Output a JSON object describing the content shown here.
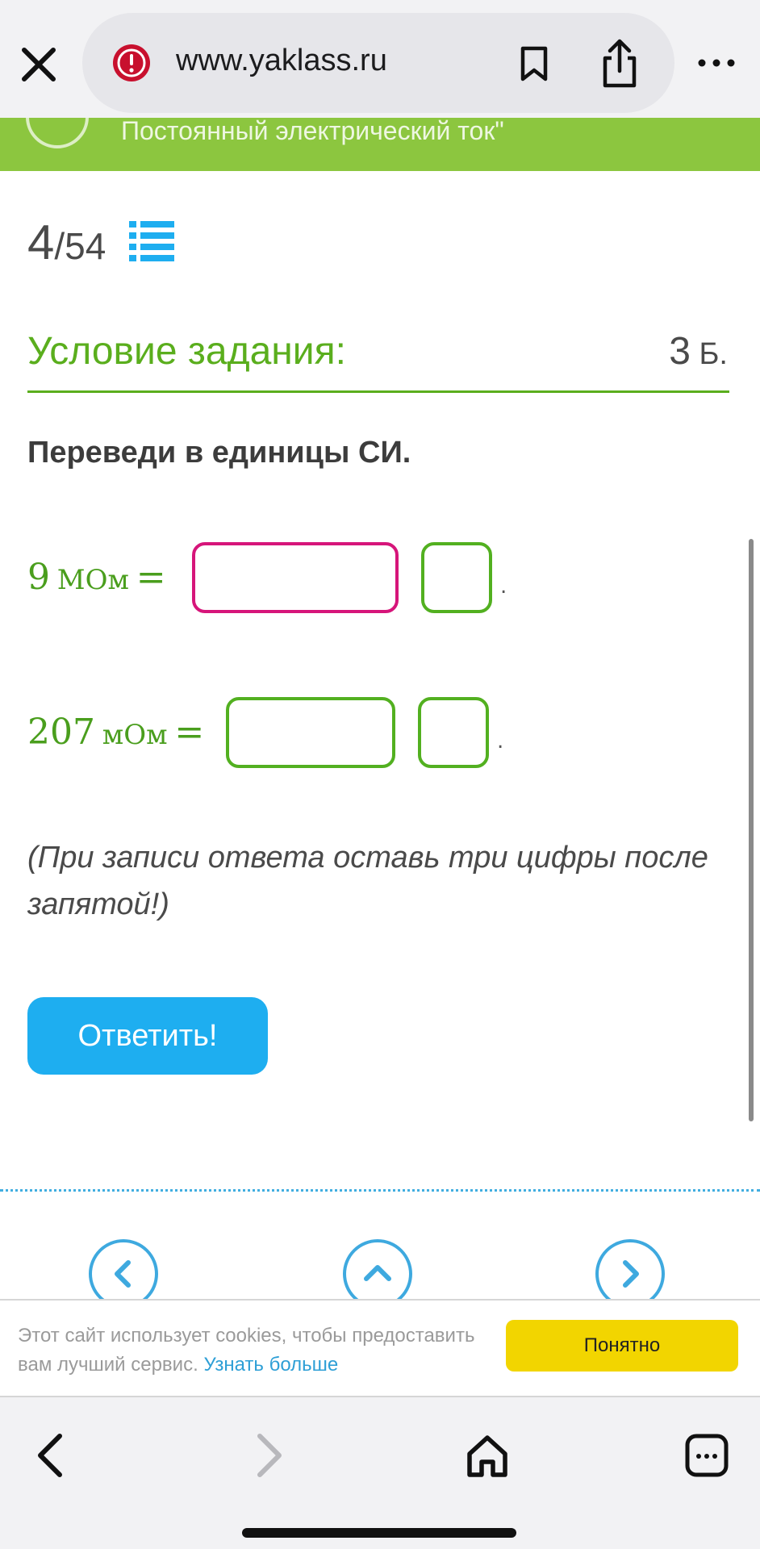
{
  "browser": {
    "url": "www.yaklass.ru"
  },
  "banner": {
    "topic": "Постоянный электрический ток\""
  },
  "progress": {
    "current": "4",
    "total": "/54"
  },
  "task": {
    "title": "Условие задания:",
    "points": "3",
    "points_unit": " Б.",
    "instruction": "Переведи в единицы СИ.",
    "equations": [
      {
        "value": "9",
        "unit": "МОм",
        "equals": "=",
        "input_value": "",
        "unit_value": "",
        "terminator": "."
      },
      {
        "value": "207",
        "unit": "мОм",
        "equals": "=",
        "input_value": "",
        "unit_value": "",
        "terminator": "."
      }
    ],
    "note": "(При записи ответа оставь три цифры после запятой!)",
    "submit_label": "Ответить!"
  },
  "cookie": {
    "text": "Этот сайт использует cookies, чтобы предоставить вам лучший сервис.",
    "link": "Узнать больше",
    "button": "Понятно"
  },
  "colors": {
    "brand_green": "#8cc63f",
    "task_green": "#5aae1d",
    "active_input": "#d6157a",
    "submit_blue": "#1eaef0",
    "cookie_yellow": "#f2d500"
  },
  "icons": {
    "close": "close-icon",
    "warning": "warning-icon",
    "bookmark": "bookmark-icon",
    "share": "share-icon",
    "more": "more-icon",
    "list": "list-icon",
    "prev": "chevron-left-icon",
    "up": "chevron-up-icon",
    "next": "chevron-right-icon",
    "back": "back-icon",
    "forward": "forward-icon",
    "home": "home-icon",
    "tabs": "tabs-icon"
  }
}
